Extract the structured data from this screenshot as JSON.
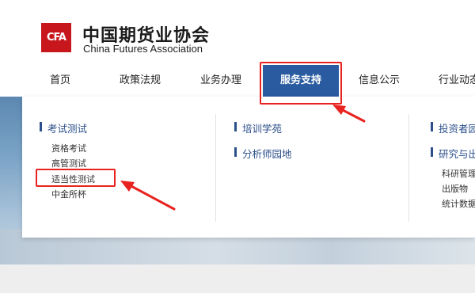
{
  "header": {
    "logo_glyph": "CFA",
    "org_name_cn": "中国期货业协会",
    "org_name_en": "China Futures Association"
  },
  "nav": {
    "items": [
      {
        "label": "首页"
      },
      {
        "label": "政策法规"
      },
      {
        "label": "业务办理"
      },
      {
        "label": "服务支持",
        "active": true
      },
      {
        "label": "信息公示"
      },
      {
        "label": "行业动态"
      }
    ]
  },
  "dropdown": {
    "col1": {
      "title": "考试测试",
      "links": [
        "资格考试",
        "高管测试",
        "适当性测试",
        "中金所杯"
      ]
    },
    "col2": {
      "titles": [
        "培训学苑",
        "分析师园地"
      ]
    },
    "col3": {
      "titles": [
        "投资者园",
        "研究与出"
      ],
      "links": [
        "科研管理",
        "出版物",
        "统计数据"
      ]
    }
  },
  "colors": {
    "brand_red": "#c8161d",
    "nav_active": "#2a5aa0",
    "annotation": "#e8231f"
  }
}
